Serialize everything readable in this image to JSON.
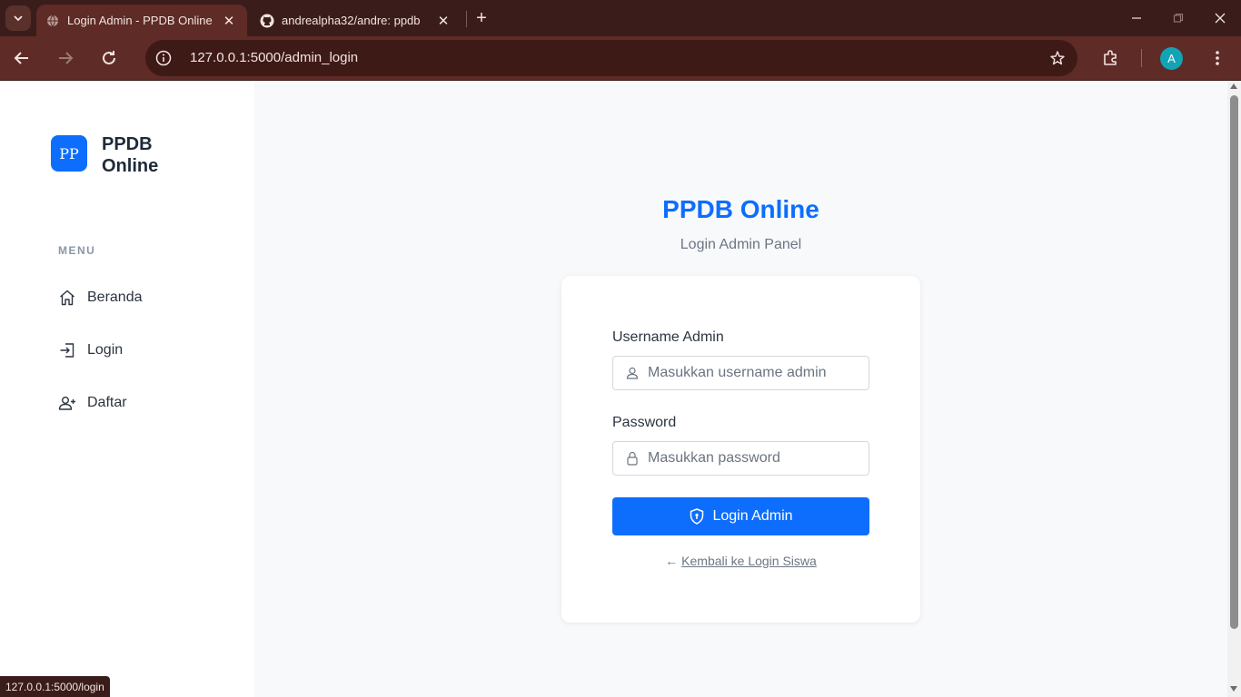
{
  "browser": {
    "tabs": [
      {
        "title": "Login Admin - PPDB Online",
        "active": true,
        "favicon": "globe-icon"
      },
      {
        "title": "andrealpha32/andre: ppdb",
        "active": false,
        "favicon": "github-icon"
      }
    ],
    "url": "127.0.0.1:5000/admin_login",
    "profile_initial": "A",
    "status_url": "127.0.0.1:5000/login"
  },
  "sidebar": {
    "logo_text": "PP",
    "brand_name": "PPDB Online",
    "menu_heading": "MENU",
    "items": [
      {
        "label": "Beranda",
        "icon": "home-icon"
      },
      {
        "label": "Login",
        "icon": "login-icon"
      },
      {
        "label": "Daftar",
        "icon": "user-plus-icon"
      }
    ]
  },
  "main": {
    "title": "PPDB Online",
    "subtitle": "Login Admin Panel",
    "form": {
      "username_label": "Username Admin",
      "username_value": "",
      "username_placeholder": "Masukkan username admin",
      "password_label": "Password",
      "password_value": "",
      "password_placeholder": "Masukkan password",
      "submit_label": "Login Admin",
      "back_arrow": "←",
      "back_link": "Kembali ke Login Siswa"
    }
  },
  "colors": {
    "primary": "#0d6efd",
    "chrome_dark": "#3a1d1a",
    "chrome_tab": "#5e2b26",
    "page_bg": "#f8f9fb"
  }
}
